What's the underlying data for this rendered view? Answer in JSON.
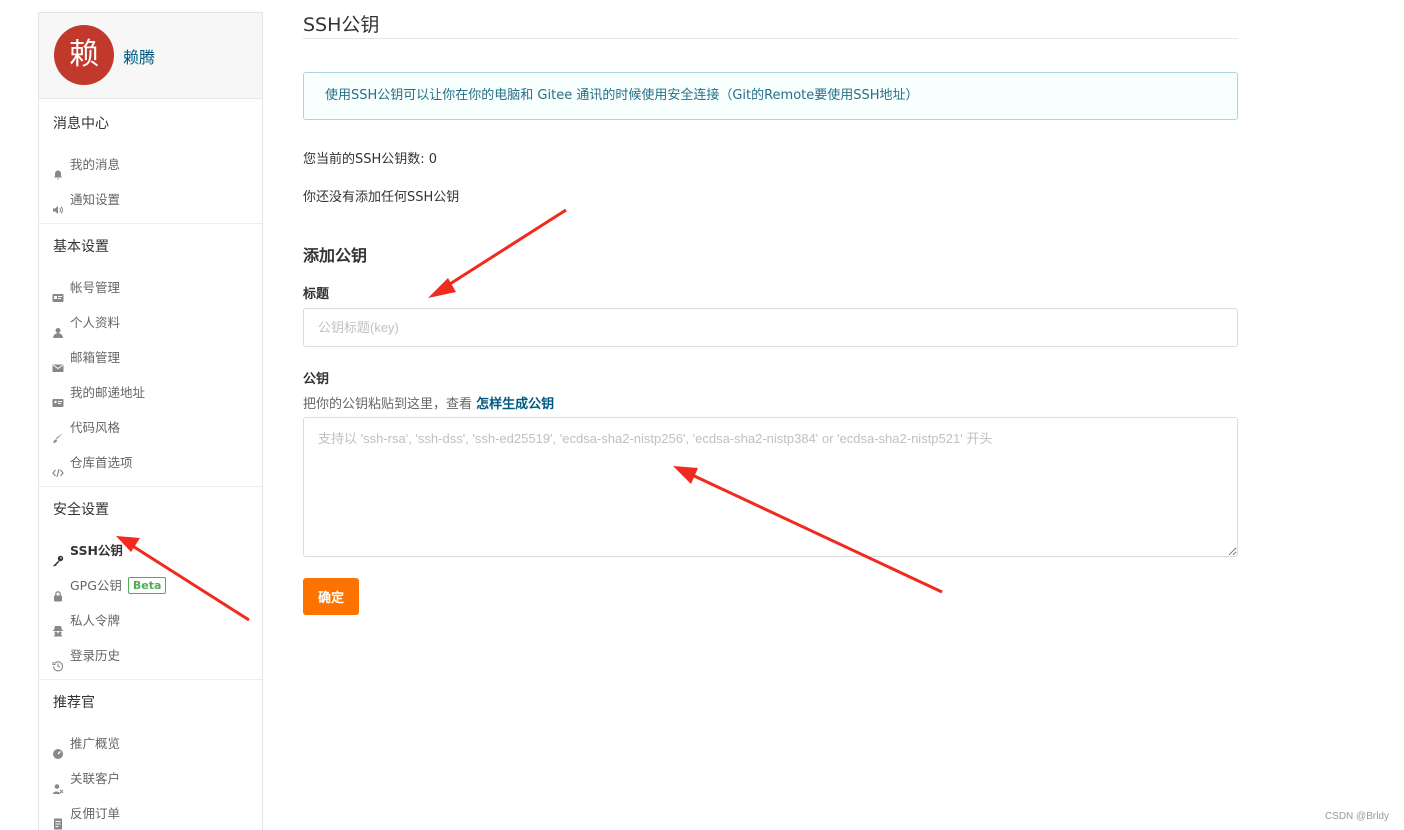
{
  "sidebar": {
    "avatar_char": "赖",
    "username": "赖腾",
    "sections": [
      {
        "title": "消息中心",
        "items": [
          {
            "label": "我的消息",
            "icon": "bell-icon"
          },
          {
            "label": "通知设置",
            "icon": "volume-icon"
          }
        ]
      },
      {
        "title": "基本设置",
        "items": [
          {
            "label": "帐号管理",
            "icon": "id-card-icon"
          },
          {
            "label": "个人资料",
            "icon": "user-icon"
          },
          {
            "label": "邮箱管理",
            "icon": "envelope-icon"
          },
          {
            "label": "我的邮递地址",
            "icon": "address-card-icon"
          },
          {
            "label": "代码风格",
            "icon": "brush-icon"
          },
          {
            "label": "仓库首选项",
            "icon": "code-icon"
          }
        ]
      },
      {
        "title": "安全设置",
        "items": [
          {
            "label": "SSH公钥",
            "icon": "key-icon",
            "active": true
          },
          {
            "label": "GPG公钥",
            "icon": "lock-icon",
            "badge": "Beta"
          },
          {
            "label": "私人令牌",
            "icon": "spy-icon"
          },
          {
            "label": "登录历史",
            "icon": "history-icon"
          }
        ]
      },
      {
        "title": "推荐官",
        "items": [
          {
            "label": "推广概览",
            "icon": "dashboard-icon"
          },
          {
            "label": "关联客户",
            "icon": "user-link-icon"
          },
          {
            "label": "反佣订单",
            "icon": "receipt-icon"
          }
        ]
      }
    ]
  },
  "main": {
    "page_title": "SSH公钥",
    "info_message": "使用SSH公钥可以让你在你的电脑和 Gitee 通讯的时候使用安全连接（Git的Remote要使用SSH地址）",
    "count_text": "您当前的SSH公钥数: 0",
    "none_text": "你还没有添加任何SSH公钥",
    "add_title": "添加公钥",
    "title_label": "标题",
    "title_placeholder": "公钥标题(key)",
    "key_label": "公钥",
    "key_hint": "把你的公钥粘贴到这里，查看 ",
    "key_hint_link": "怎样生成公钥",
    "key_placeholder": "支持以 'ssh-rsa', 'ssh-dss', 'ssh-ed25519', 'ecdsa-sha2-nistp256', 'ecdsa-sha2-nistp384' or 'ecdsa-sha2-nistp521' 开头",
    "submit_label": "确定"
  },
  "watermark": "CSDN @Brldy",
  "colors": {
    "accent": "#fe7300",
    "link": "#005980",
    "info_border": "#a9d5de",
    "info_text": "#276f86",
    "avatar_bg": "#c0392b",
    "annotation_arrow": "#f02a1e",
    "beta": "#4caf50"
  }
}
